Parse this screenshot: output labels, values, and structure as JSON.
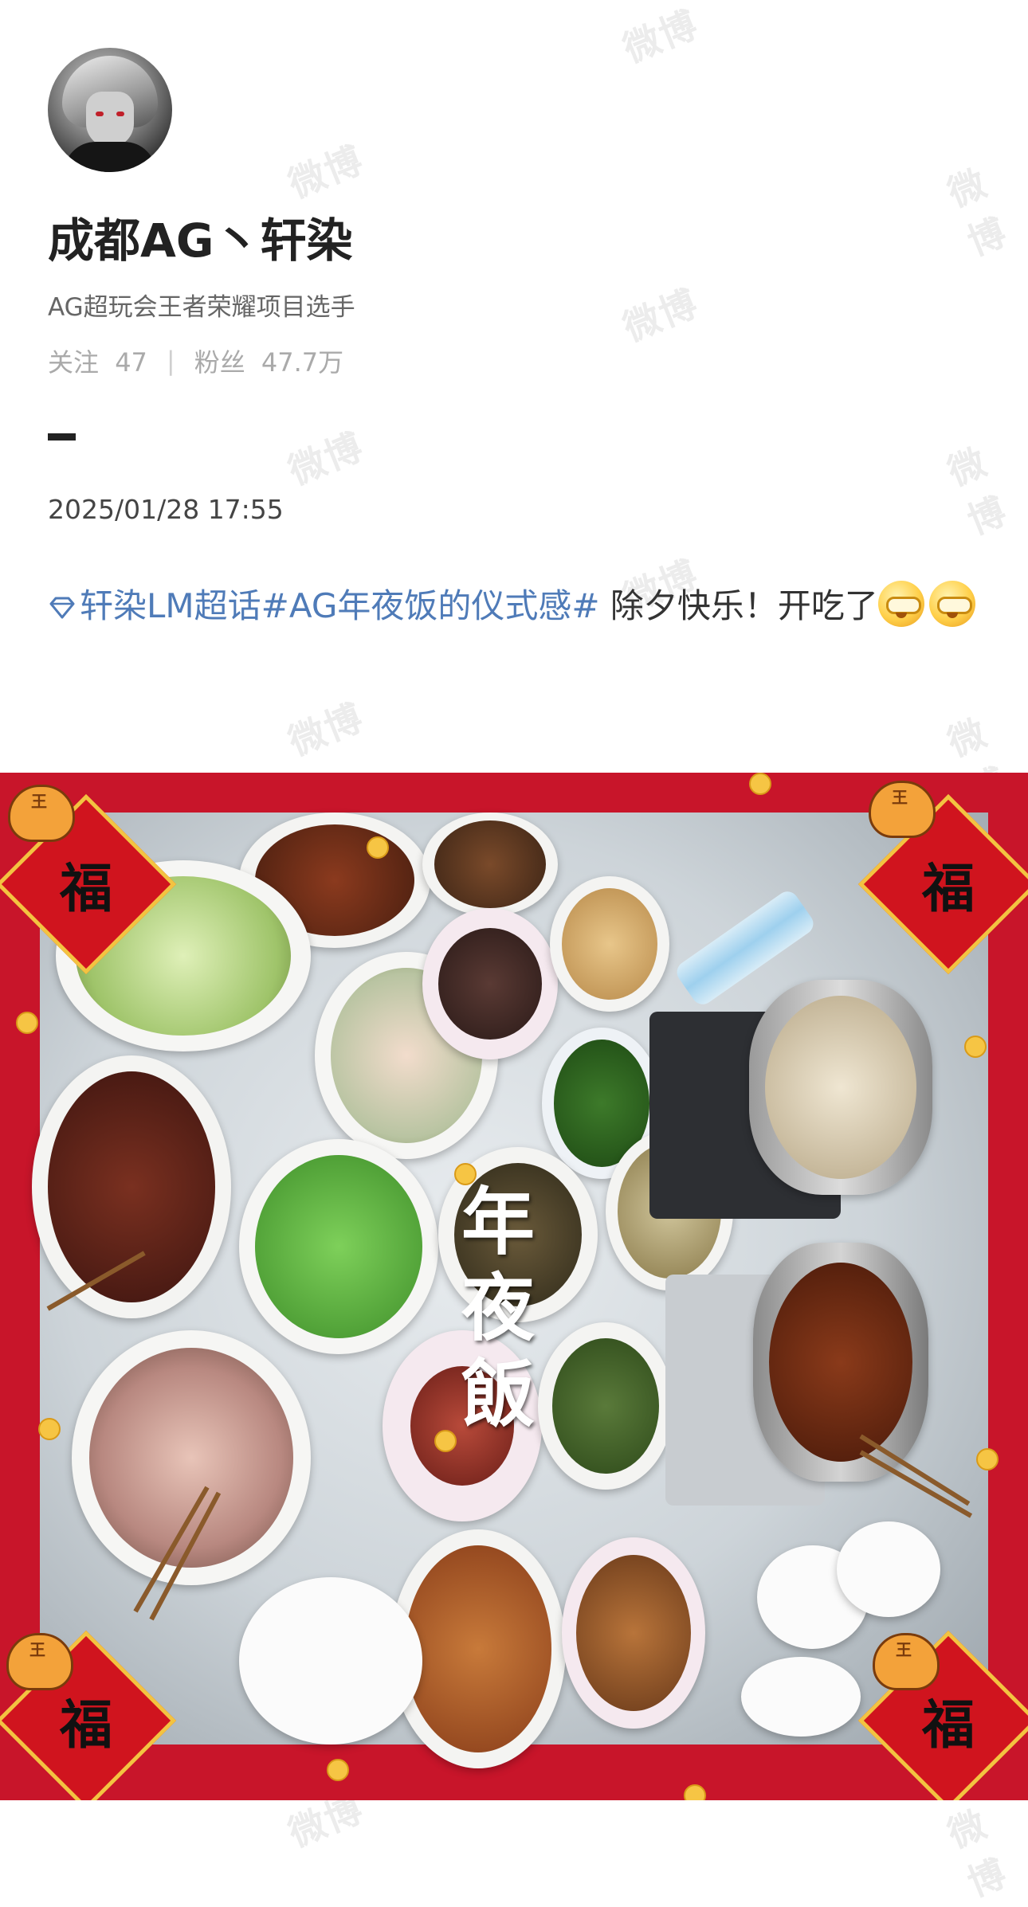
{
  "watermark": "微博",
  "profile": {
    "username": "成都AG丶轩染",
    "bio": "AG超玩会王者荣耀项目选手",
    "following_label": "关注",
    "following_count": "47",
    "followers_label": "粉丝",
    "followers_count": "47.7万"
  },
  "post": {
    "timestamp": "2025/01/28 17:55",
    "topic_supertopic": "轩染LM超话",
    "topic_hashtag": "#AG年夜饭的仪式感#",
    "text": " 除夕快乐！开吃了",
    "emoji_icon": "lol-emoji-icon"
  },
  "photo": {
    "overlay_text_line1": "年",
    "overlay_text_line2": "夜",
    "overlay_text_line3": "飯",
    "fu_character": "福",
    "frame_color": "#c8152a"
  },
  "colors": {
    "topic_blue": "#4f7bb8",
    "text_dark": "#222222",
    "text_gray": "#666666"
  }
}
